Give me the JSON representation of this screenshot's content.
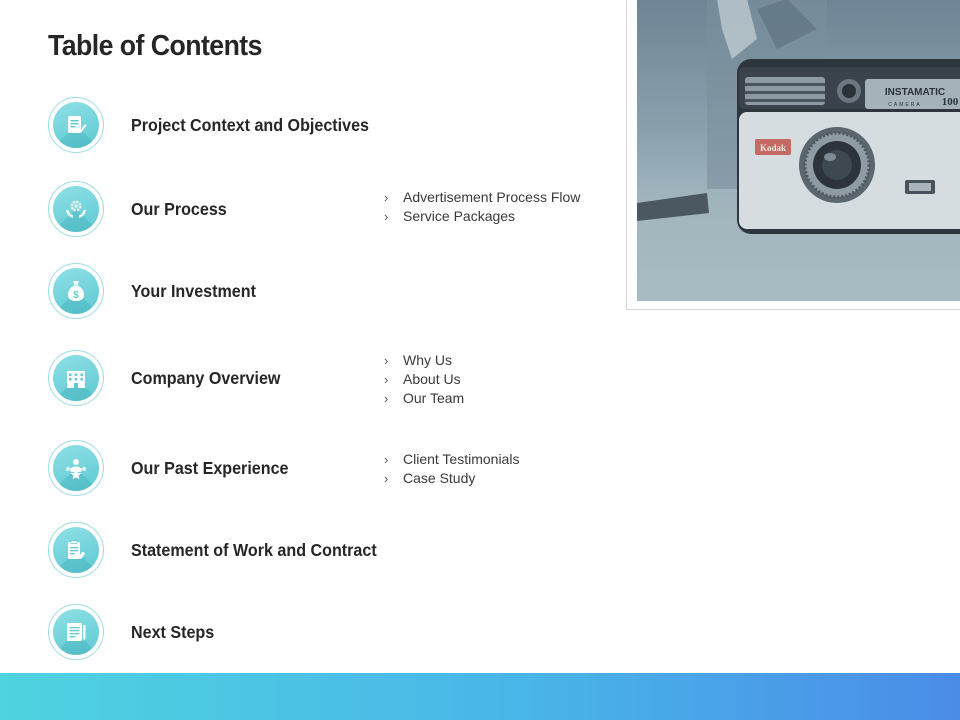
{
  "title": "Table of Contents",
  "items": [
    {
      "label": "Project Context and Objectives",
      "icon": "document-pen-icon",
      "subitems": []
    },
    {
      "label": "Our Process",
      "icon": "gear-hands-icon",
      "subitems": [
        "Advertisement Process Flow",
        "Service Packages"
      ]
    },
    {
      "label": "Your Investment",
      "icon": "money-bag-icon",
      "subitems": []
    },
    {
      "label": "Company Overview",
      "icon": "building-icon",
      "subitems": [
        "Why Us",
        "About Us",
        "Our Team"
      ]
    },
    {
      "label": "Our Past Experience",
      "icon": "team-stars-icon",
      "subitems": [
        "Client Testimonials",
        "Case Study"
      ]
    },
    {
      "label": "Statement of Work and Contract",
      "icon": "clipboard-icon",
      "subitems": []
    },
    {
      "label": "Next Steps",
      "icon": "notebook-icon",
      "subitems": []
    }
  ],
  "colors": {
    "accent": "#5ec9d2",
    "footer_start": "#4fd3e0",
    "footer_end": "#4a8ce8"
  },
  "photo": {
    "camera_brand": "INSTAMATIC",
    "camera_model": "100",
    "camera_sublabel": "CAMERA",
    "badge": "Kodak"
  }
}
